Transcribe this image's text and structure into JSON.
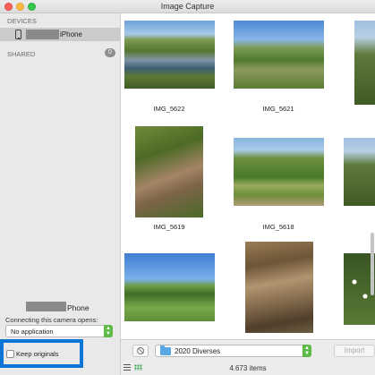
{
  "window": {
    "title": "Image Capture"
  },
  "sidebar": {
    "devices_header": "DEVICES",
    "device_name": "iPhone",
    "shared_header": "SHARED",
    "shared_count": "0",
    "selected_device_name": "Phone",
    "opens_label": "Connecting this camera opens:",
    "opens_app": "No application",
    "keep_originals_label": "Keep originals",
    "keep_originals_checked": false
  },
  "photos": [
    {
      "label": "IMG_5622",
      "icon": "photo-thumbnail"
    },
    {
      "label": "IMG_5621",
      "icon": "photo-thumbnail"
    },
    {
      "label": "IMG_5619",
      "icon": "photo-thumbnail"
    },
    {
      "label": "IMG_5618",
      "icon": "photo-thumbnail"
    }
  ],
  "bottombar": {
    "import_folder": "2020 Diverses",
    "import_button": "Import",
    "items_count": "4.673 items"
  },
  "colors": {
    "highlight_border": "#0b76d6",
    "popup_accent": "#5dbb46",
    "folder_icon": "#59a8e6"
  }
}
